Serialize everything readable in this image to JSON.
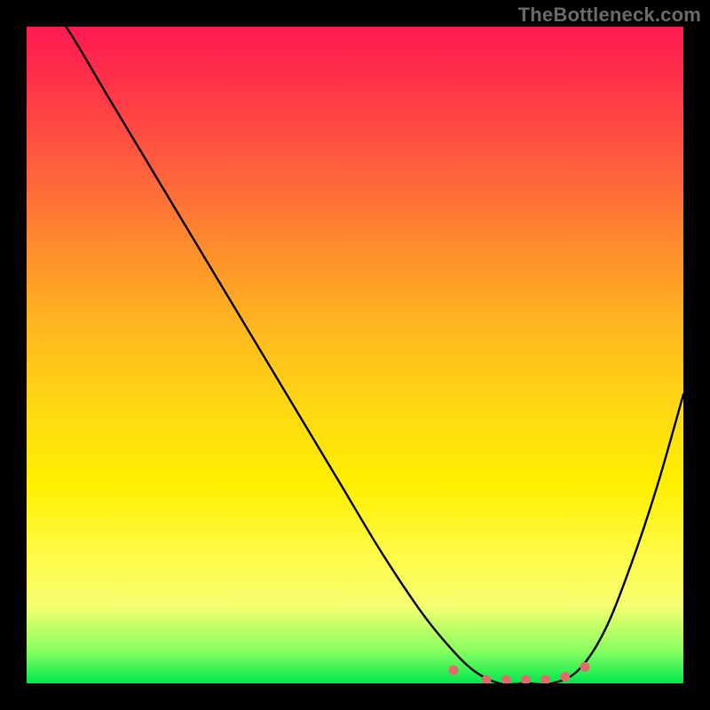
{
  "watermark": "TheBottleneck.com",
  "chart_data": {
    "type": "line",
    "title": "",
    "xlabel": "",
    "ylabel": "",
    "xlim": [
      0,
      100
    ],
    "ylim": [
      0,
      100
    ],
    "x": [
      0,
      6,
      12,
      18,
      24,
      30,
      36,
      42,
      48,
      54,
      60,
      64,
      68,
      72,
      76,
      80,
      84,
      88,
      92,
      96,
      100
    ],
    "curve_y": [
      108,
      100,
      90,
      80,
      70,
      60,
      50,
      40,
      30,
      20,
      11,
      6,
      2,
      0,
      0,
      0,
      2,
      8,
      18,
      30,
      44
    ],
    "dots": [
      {
        "x": 65,
        "y": 2
      },
      {
        "x": 70,
        "y": 0.5
      },
      {
        "x": 73,
        "y": 0.5
      },
      {
        "x": 76,
        "y": 0.5
      },
      {
        "x": 79,
        "y": 0.5
      },
      {
        "x": 82,
        "y": 1
      },
      {
        "x": 85,
        "y": 2.5
      }
    ],
    "dot_color": "#e26a6a",
    "line_color": "#000000",
    "background_gradient": [
      "#ff1a52",
      "#ff8a2e",
      "#fff000",
      "#00e84e"
    ]
  }
}
